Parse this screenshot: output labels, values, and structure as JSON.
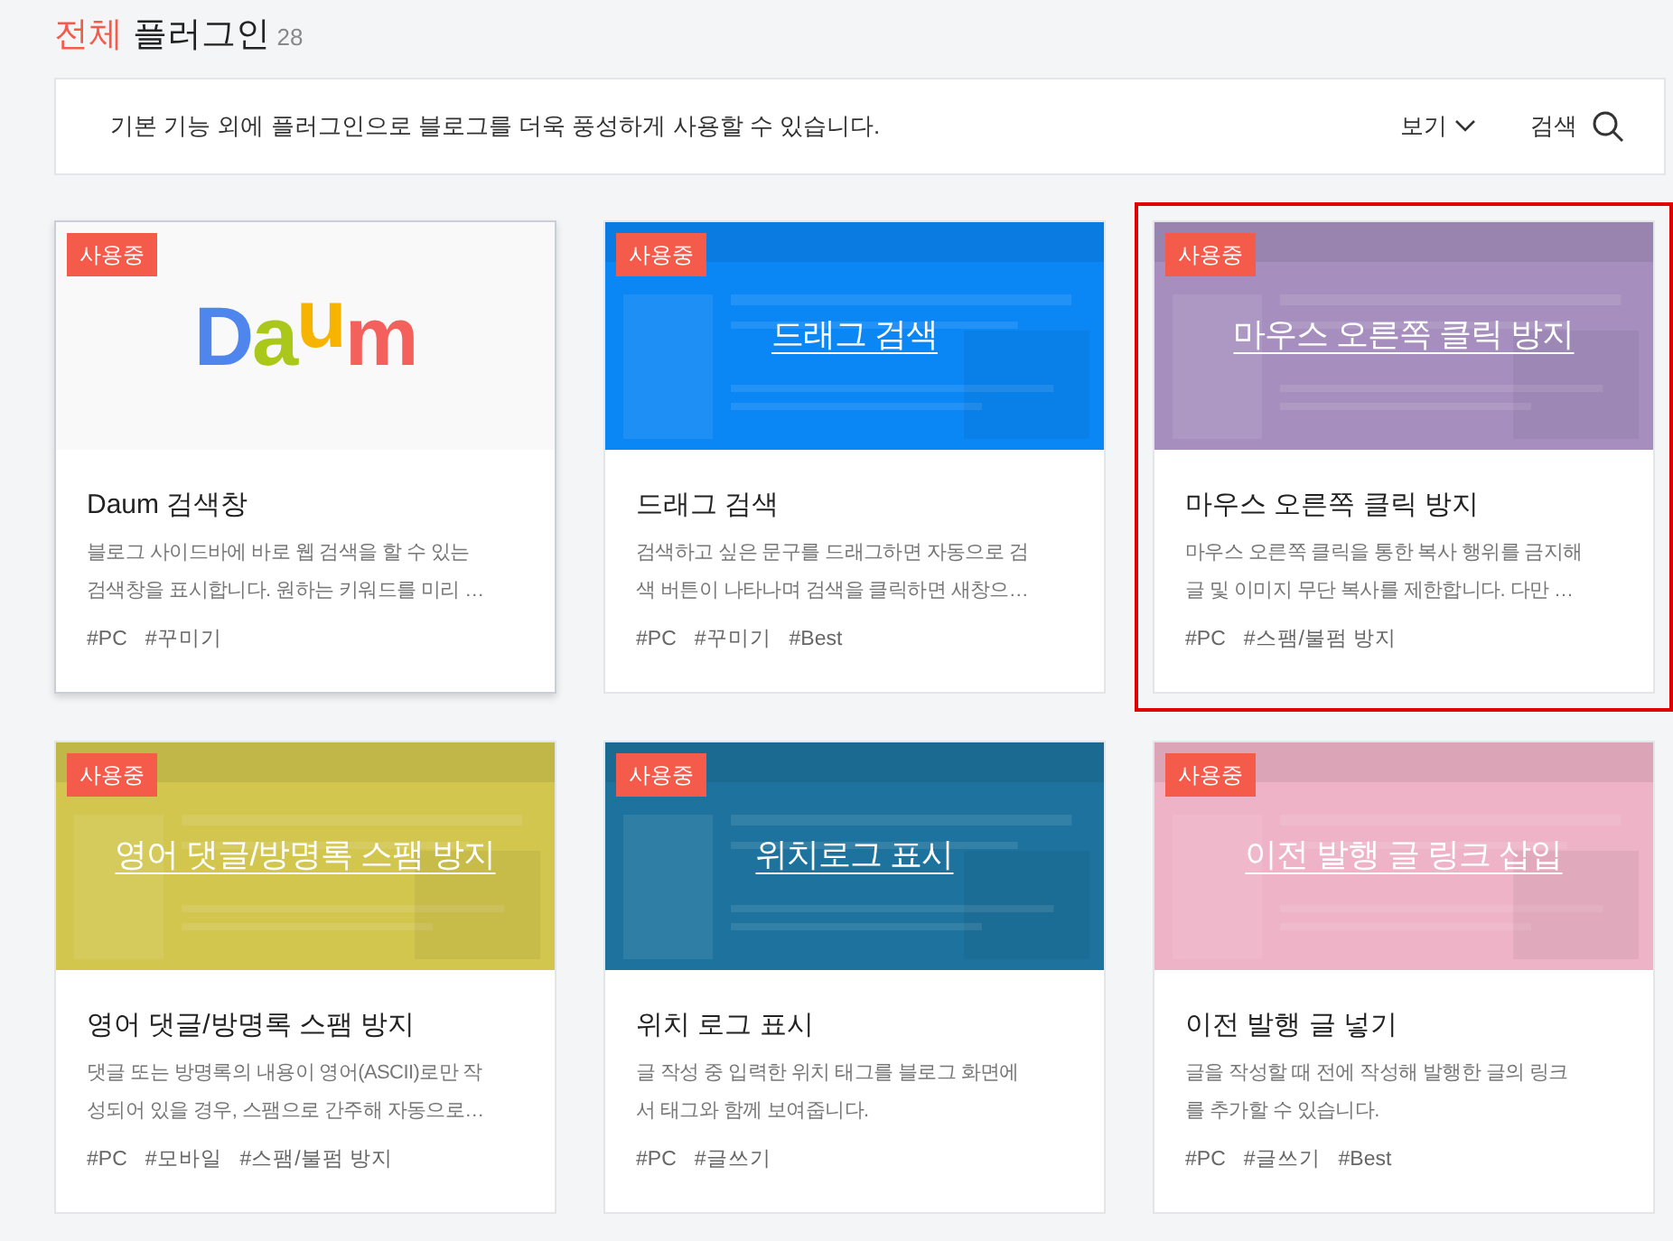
{
  "header": {
    "highlight": "전체",
    "title": "플러그인",
    "count": "28"
  },
  "toolbar": {
    "description": "기본 기능 외에 플러그인으로 블로그를 더욱 풍성하게 사용할 수 있습니다.",
    "view": "보기",
    "search": "검색"
  },
  "plugins": [
    {
      "kind": "logo",
      "logo": "Daum",
      "badge": "사용중",
      "in_use": true,
      "hovered": true,
      "highlighted": false,
      "name": "Daum 검색창",
      "description_lines": [
        "블로그 사이드바에 바로 웹 검색을 할 수 있는",
        "검색창을 표시합니다. 원하는 키워드를 미리 …"
      ],
      "tags": [
        "#PC",
        "#꾸미기"
      ]
    },
    {
      "kind": "picture",
      "color": "#0a86f5",
      "thumb_title": "드래그 검색",
      "badge": "사용중",
      "in_use": true,
      "hovered": false,
      "highlighted": false,
      "name": "드래그 검색",
      "description_lines": [
        "검색하고 싶은 문구를 드래그하면 자동으로 검",
        "색 버튼이 나타나며 검색을 클릭하면 새창으…"
      ],
      "tags": [
        "#PC",
        "#꾸미기",
        "#Best"
      ]
    },
    {
      "kind": "picture",
      "color": "#a68fbe",
      "thumb_title": "마우스 오른쪽 클릭 방지",
      "badge": "사용중",
      "in_use": true,
      "hovered": false,
      "highlighted": true,
      "name": "마우스 오른쪽 클릭 방지",
      "description_lines": [
        "마우스 오른쪽 클릭을 통한 복사 행위를 금지해",
        "글 및 이미지 무단 복사를 제한합니다. 다만 …"
      ],
      "tags": [
        "#PC",
        "#스팸/불펌 방지"
      ]
    },
    {
      "kind": "picture",
      "color": "#d2c64f",
      "thumb_title": "영어 댓글/방명록 스팸 방지",
      "badge": "사용중",
      "in_use": true,
      "hovered": false,
      "highlighted": false,
      "name": "영어 댓글/방명록 스팸 방지",
      "description_lines": [
        "댓글 또는 방명록의 내용이 영어(ASCII)로만 작",
        "성되어 있을 경우, 스팸으로 간주해 자동으로…"
      ],
      "tags": [
        "#PC",
        "#모바일",
        "#스팸/불펌 방지"
      ]
    },
    {
      "kind": "picture",
      "color": "#1d739e",
      "thumb_title": "위치로그 표시",
      "badge": "사용중",
      "in_use": true,
      "hovered": false,
      "highlighted": false,
      "name": "위치 로그 표시",
      "description_lines": [
        "글 작성 중 입력한 위치 태그를 블로그 화면에",
        "서 태그와 함께 보여줍니다."
      ],
      "tags": [
        "#PC",
        "#글쓰기"
      ]
    },
    {
      "kind": "picture",
      "color": "#eeb3c7",
      "thumb_title": "이전 발행 글 링크 삽입",
      "badge": "사용중",
      "in_use": true,
      "hovered": false,
      "highlighted": false,
      "name": "이전 발행 글 넣기",
      "description_lines": [
        "글을 작성할 때 전에 작성해 발행한 글의 링크",
        "를 추가할 수 있습니다."
      ],
      "tags": [
        "#PC",
        "#글쓰기",
        "#Best"
      ]
    }
  ]
}
